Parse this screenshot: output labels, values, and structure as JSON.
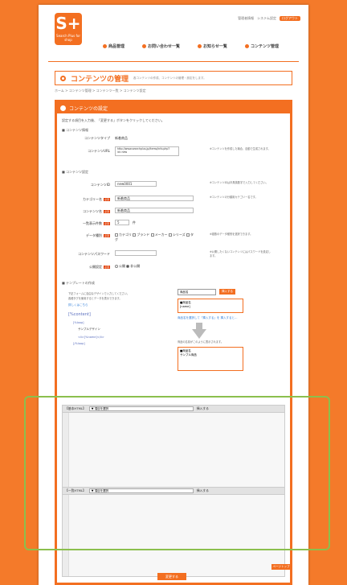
{
  "header": {
    "logo_mark": "S+",
    "logo_name": "Search Plus for shop",
    "toplinks": [
      "管理者情報",
      "システム設定",
      "ログアウト"
    ],
    "nav": [
      "商品管理",
      "お問い合わせ一覧",
      "お知らせ一覧",
      "コンテンツ管理"
    ]
  },
  "page": {
    "title": "コンテンツの管理",
    "title_desc": "各コンテンツの作成、コンテンツの管理・設定をします。",
    "breadcrumb": "ホーム > コンテンツ管理 > コンテンツ一覧 > コンテンツ設定"
  },
  "panel": {
    "heading": "コンテンツの設定",
    "intro": "設定する項目を入力後、「変更する」ボタンをクリックしてください。",
    "sec_basic": "■ コンテンツ情報",
    "content_type_label": "コンテンツタイプ",
    "content_type_value": "新着商品",
    "content_url_label": "コンテンツURL",
    "content_url_value": "http://www.searchplus.jp/items/info.php?id=new",
    "content_url_note": "※コンテンツを作成した場合、自動で生成されます。",
    "sec_settings": "■ コンテンツ設定",
    "content_id_label": "コンテンツID",
    "content_id_value": "new0001",
    "content_id_note": "※コンテンツIDは半角英数字で入力してください。",
    "category_label": "カテゴリー名",
    "category_value": "新着商品",
    "category_note": "※コンテンツの分類用カテゴリー名です。",
    "content_name_label": "コンテンツ名",
    "content_name_value": "新着商品",
    "count_label": "一覧表示件数",
    "count_value": "5",
    "count_unit": "件",
    "data_label": "データ種別",
    "data_options": [
      "カテゴリ",
      "ブランド",
      "メーカー",
      "シリーズ",
      "タグ"
    ],
    "data_note": "※複数のデータ種別を選択できます。",
    "password_label": "コンテンツパスワード",
    "password_note": "※公開したくないコンテンツにはパスワードを設定します。",
    "publish_label": "公開設定",
    "publish_options": [
      "公開",
      "非公開"
    ],
    "sec_template": "■ テンプレートの作成",
    "tpl_desc1": "下記フォームに自由なデザインで入力してください。",
    "tpl_desc2": "各種タグを使用するとデータを表示できます。",
    "tpl_link": "詳しくはこちら",
    "code_lines": [
      "[%content]",
      "[%loop]",
      "<li>[%name]</li>",
      "[/%loop]"
    ],
    "code_sample": "サンプルデザイン",
    "tag_select": "商品名",
    "tag_insert": "挿入する",
    "preview_lines": [
      "■商品名",
      "[name]"
    ],
    "preview_caption": "商品名を選択して「挿入する」を 挿入すると…",
    "result_caption": "商品の名前がこのように表示されます。",
    "result_lines": [
      "■商品名",
      "サンプル商品"
    ],
    "editor1_label": "【基本HTML】",
    "editor1_select": "▼ 項目を選択",
    "editor1_insert": "挿入する",
    "editor2_label": "【一覧HTML】",
    "editor2_select": "▼ 項目を選択",
    "editor2_insert": "挿入する",
    "page_top": "ページトップ",
    "submit": "変更する"
  }
}
